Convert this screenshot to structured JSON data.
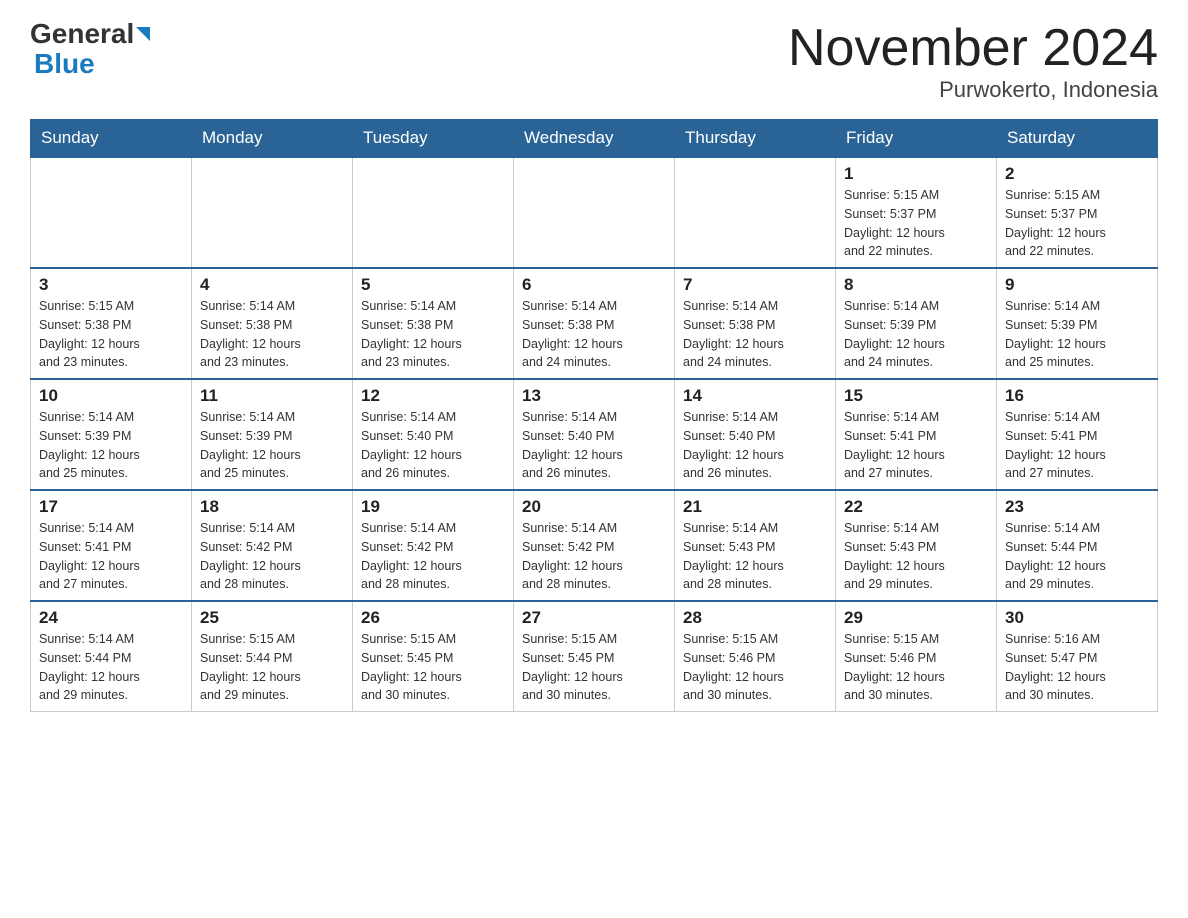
{
  "header": {
    "logo_line1": "General",
    "logo_line2": "Blue",
    "title": "November 2024",
    "subtitle": "Purwokerto, Indonesia"
  },
  "weekdays": [
    "Sunday",
    "Monday",
    "Tuesday",
    "Wednesday",
    "Thursday",
    "Friday",
    "Saturday"
  ],
  "weeks": [
    [
      {
        "day": "",
        "info": ""
      },
      {
        "day": "",
        "info": ""
      },
      {
        "day": "",
        "info": ""
      },
      {
        "day": "",
        "info": ""
      },
      {
        "day": "",
        "info": ""
      },
      {
        "day": "1",
        "info": "Sunrise: 5:15 AM\nSunset: 5:37 PM\nDaylight: 12 hours\nand 22 minutes."
      },
      {
        "day": "2",
        "info": "Sunrise: 5:15 AM\nSunset: 5:37 PM\nDaylight: 12 hours\nand 22 minutes."
      }
    ],
    [
      {
        "day": "3",
        "info": "Sunrise: 5:15 AM\nSunset: 5:38 PM\nDaylight: 12 hours\nand 23 minutes."
      },
      {
        "day": "4",
        "info": "Sunrise: 5:14 AM\nSunset: 5:38 PM\nDaylight: 12 hours\nand 23 minutes."
      },
      {
        "day": "5",
        "info": "Sunrise: 5:14 AM\nSunset: 5:38 PM\nDaylight: 12 hours\nand 23 minutes."
      },
      {
        "day": "6",
        "info": "Sunrise: 5:14 AM\nSunset: 5:38 PM\nDaylight: 12 hours\nand 24 minutes."
      },
      {
        "day": "7",
        "info": "Sunrise: 5:14 AM\nSunset: 5:38 PM\nDaylight: 12 hours\nand 24 minutes."
      },
      {
        "day": "8",
        "info": "Sunrise: 5:14 AM\nSunset: 5:39 PM\nDaylight: 12 hours\nand 24 minutes."
      },
      {
        "day": "9",
        "info": "Sunrise: 5:14 AM\nSunset: 5:39 PM\nDaylight: 12 hours\nand 25 minutes."
      }
    ],
    [
      {
        "day": "10",
        "info": "Sunrise: 5:14 AM\nSunset: 5:39 PM\nDaylight: 12 hours\nand 25 minutes."
      },
      {
        "day": "11",
        "info": "Sunrise: 5:14 AM\nSunset: 5:39 PM\nDaylight: 12 hours\nand 25 minutes."
      },
      {
        "day": "12",
        "info": "Sunrise: 5:14 AM\nSunset: 5:40 PM\nDaylight: 12 hours\nand 26 minutes."
      },
      {
        "day": "13",
        "info": "Sunrise: 5:14 AM\nSunset: 5:40 PM\nDaylight: 12 hours\nand 26 minutes."
      },
      {
        "day": "14",
        "info": "Sunrise: 5:14 AM\nSunset: 5:40 PM\nDaylight: 12 hours\nand 26 minutes."
      },
      {
        "day": "15",
        "info": "Sunrise: 5:14 AM\nSunset: 5:41 PM\nDaylight: 12 hours\nand 27 minutes."
      },
      {
        "day": "16",
        "info": "Sunrise: 5:14 AM\nSunset: 5:41 PM\nDaylight: 12 hours\nand 27 minutes."
      }
    ],
    [
      {
        "day": "17",
        "info": "Sunrise: 5:14 AM\nSunset: 5:41 PM\nDaylight: 12 hours\nand 27 minutes."
      },
      {
        "day": "18",
        "info": "Sunrise: 5:14 AM\nSunset: 5:42 PM\nDaylight: 12 hours\nand 28 minutes."
      },
      {
        "day": "19",
        "info": "Sunrise: 5:14 AM\nSunset: 5:42 PM\nDaylight: 12 hours\nand 28 minutes."
      },
      {
        "day": "20",
        "info": "Sunrise: 5:14 AM\nSunset: 5:42 PM\nDaylight: 12 hours\nand 28 minutes."
      },
      {
        "day": "21",
        "info": "Sunrise: 5:14 AM\nSunset: 5:43 PM\nDaylight: 12 hours\nand 28 minutes."
      },
      {
        "day": "22",
        "info": "Sunrise: 5:14 AM\nSunset: 5:43 PM\nDaylight: 12 hours\nand 29 minutes."
      },
      {
        "day": "23",
        "info": "Sunrise: 5:14 AM\nSunset: 5:44 PM\nDaylight: 12 hours\nand 29 minutes."
      }
    ],
    [
      {
        "day": "24",
        "info": "Sunrise: 5:14 AM\nSunset: 5:44 PM\nDaylight: 12 hours\nand 29 minutes."
      },
      {
        "day": "25",
        "info": "Sunrise: 5:15 AM\nSunset: 5:44 PM\nDaylight: 12 hours\nand 29 minutes."
      },
      {
        "day": "26",
        "info": "Sunrise: 5:15 AM\nSunset: 5:45 PM\nDaylight: 12 hours\nand 30 minutes."
      },
      {
        "day": "27",
        "info": "Sunrise: 5:15 AM\nSunset: 5:45 PM\nDaylight: 12 hours\nand 30 minutes."
      },
      {
        "day": "28",
        "info": "Sunrise: 5:15 AM\nSunset: 5:46 PM\nDaylight: 12 hours\nand 30 minutes."
      },
      {
        "day": "29",
        "info": "Sunrise: 5:15 AM\nSunset: 5:46 PM\nDaylight: 12 hours\nand 30 minutes."
      },
      {
        "day": "30",
        "info": "Sunrise: 5:16 AM\nSunset: 5:47 PM\nDaylight: 12 hours\nand 30 minutes."
      }
    ]
  ]
}
